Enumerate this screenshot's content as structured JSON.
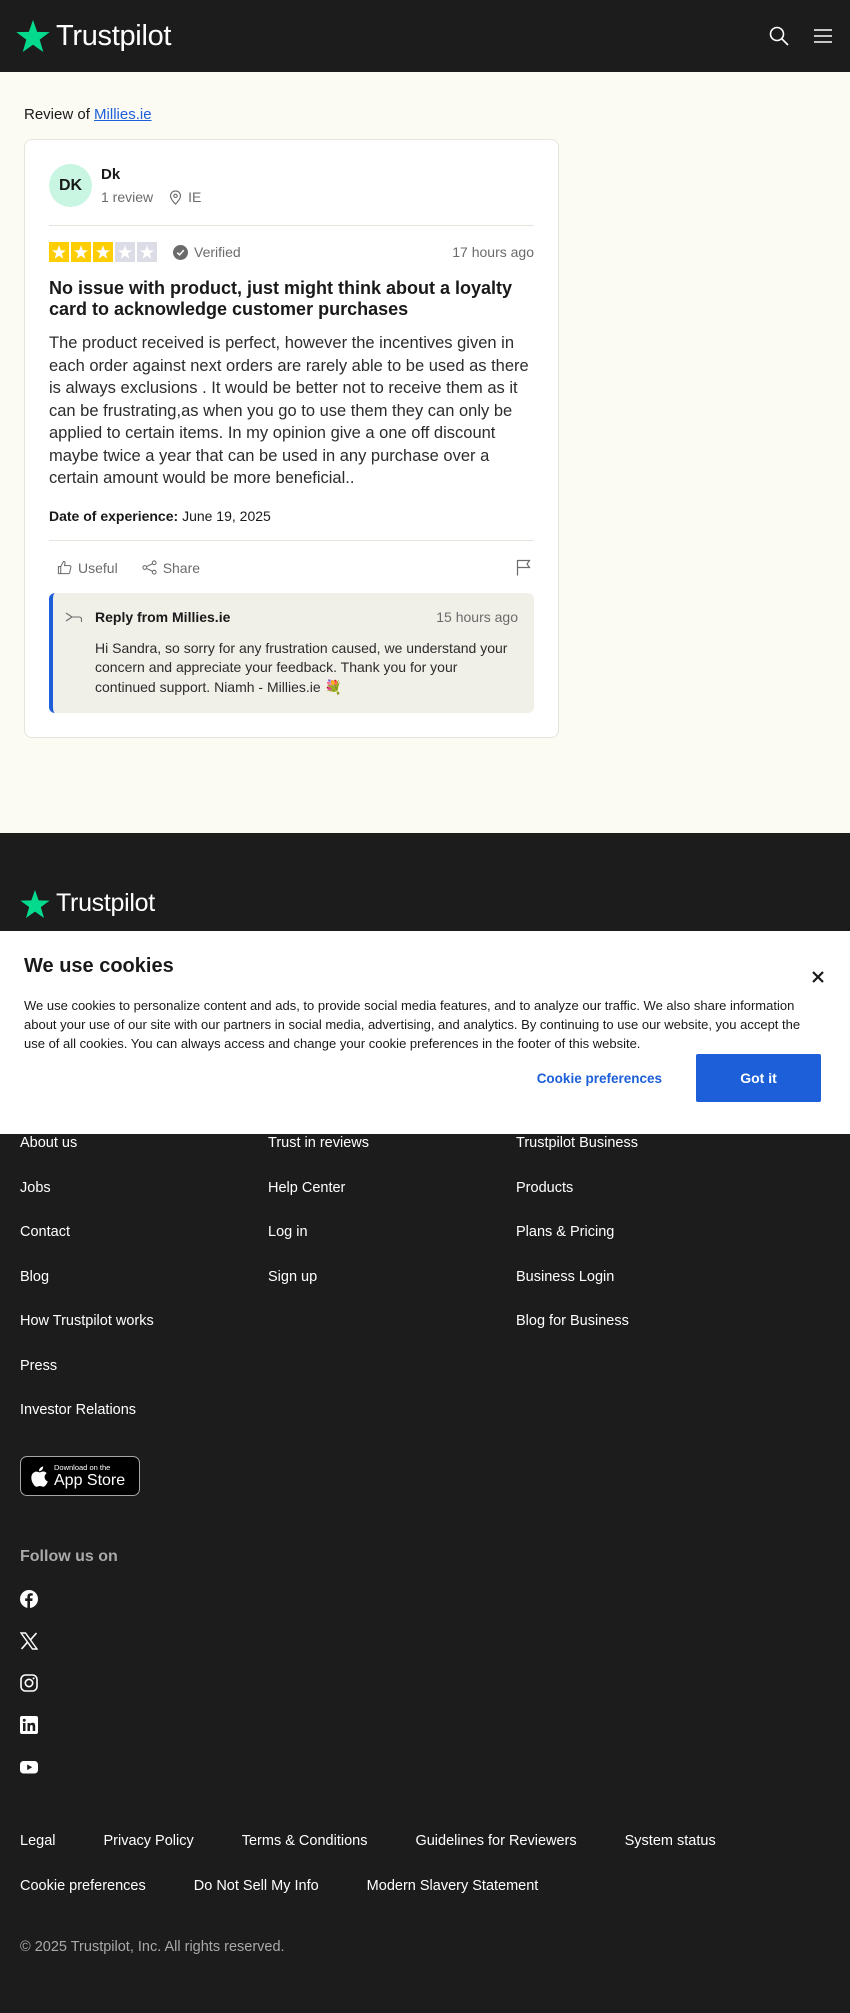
{
  "header": {
    "logo_text": "Trustpilot",
    "search_icon": "search-icon",
    "menu_icon": "hamburger-menu-icon"
  },
  "page": {
    "review_of_prefix": "Review of ",
    "business_name": "Millies.ie"
  },
  "review": {
    "reviewer_initials": "DK",
    "reviewer_name": "Dk",
    "review_count": "1 review",
    "country": "IE",
    "rating": 3,
    "max_rating": 5,
    "verified_label": "Verified",
    "time_ago": "17 hours ago",
    "title": "No issue with product, just might think about a loyalty card to acknowledge customer purchases",
    "body": "The product received is perfect, however the incentives given in each order against next orders are rarely able to be used as there is always exclusions . It would be better not to receive them as it can be frustrating,as when you go to use them they can only be applied to certain items. In my opinion give a one off discount maybe twice a year that can be used in any purchase over a certain amount would be more beneficial..",
    "date_label": "Date of experience:",
    "date_value": "June 19, 2025",
    "useful_label": "Useful",
    "share_label": "Share"
  },
  "reply": {
    "from_label": "Reply from Millies.ie",
    "time_ago": "15 hours ago",
    "body": "Hi Sandra, so sorry for any frustration caused, we understand your concern and appreciate your feedback. Thank you for your continued support. Niamh - Millies.ie 💐"
  },
  "cookie": {
    "title": "We use cookies",
    "text": "We use cookies to personalize content and ads, to provide social media features, and to analyze our traffic. We also share information about your use of our site with our partners in social media, advertising, and analytics. By continuing to use our website, you accept the use of all cookies. You can always access and change your cookie preferences in the footer of this website.",
    "preferences_label": "Cookie preferences",
    "accept_label": "Got it"
  },
  "footer": {
    "logo_text": "Trustpilot",
    "columns": [
      [
        "About us",
        "Jobs",
        "Contact",
        "Blog",
        "How Trustpilot works",
        "Press",
        "Investor Relations"
      ],
      [
        "Trust in reviews",
        "Help Center",
        "Log in",
        "Sign up"
      ],
      [
        "Trustpilot Business",
        "Products",
        "Plans & Pricing",
        "Business Login",
        "Blog for Business"
      ]
    ],
    "app_store_small": "Download on the",
    "app_store_big": "App Store",
    "follow_label": "Follow us on",
    "socials": [
      "facebook-icon",
      "x-icon",
      "instagram-icon",
      "linkedin-icon",
      "youtube-icon"
    ],
    "legal_row1": [
      "Legal",
      "Privacy Policy",
      "Terms & Conditions",
      "Guidelines for Reviewers",
      "System status"
    ],
    "legal_row2": [
      "Cookie preferences",
      "Do Not Sell My Info",
      "Modern Slavery Statement"
    ],
    "copyright": "© 2025 Trustpilot, Inc. All rights reserved."
  },
  "colors": {
    "brand_green": "#04da8d",
    "star_yellow": "#ffce00",
    "link_blue": "#1c5fd8",
    "dark_bg": "#1c1c1c"
  }
}
